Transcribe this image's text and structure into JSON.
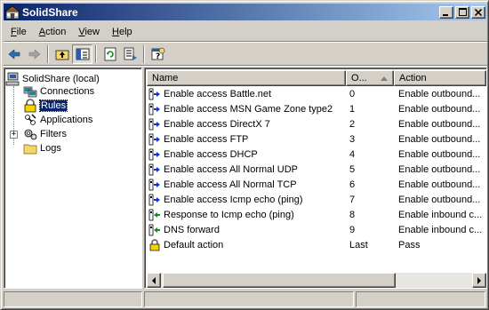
{
  "window": {
    "title": "SolidShare"
  },
  "menu": {
    "items": [
      {
        "label": "File",
        "accel": "F"
      },
      {
        "label": "Action",
        "accel": "A"
      },
      {
        "label": "View",
        "accel": "V"
      },
      {
        "label": "Help",
        "accel": "H"
      }
    ]
  },
  "toolbar": {
    "buttons": [
      "back-icon",
      "forward-icon",
      "up-one-level-icon",
      "show-hide-tree-icon",
      "refresh-icon",
      "export-list-icon",
      "help-icon"
    ]
  },
  "tree": {
    "root": "SolidShare (local)",
    "items": [
      "Connections",
      "Rules",
      "Applications",
      "Filters",
      "Logs"
    ],
    "selected": "Rules",
    "filters_expander": "+"
  },
  "list": {
    "columns": [
      "Name",
      "O...",
      "Action"
    ],
    "rows": [
      {
        "name": "Enable access Battle.net",
        "order": "0",
        "action": "Enable outbound...",
        "dir": "out"
      },
      {
        "name": "Enable access MSN Game Zone type2",
        "order": "1",
        "action": "Enable outbound...",
        "dir": "out"
      },
      {
        "name": "Enable access DirectX 7",
        "order": "2",
        "action": "Enable outbound...",
        "dir": "out"
      },
      {
        "name": "Enable access FTP",
        "order": "3",
        "action": "Enable outbound...",
        "dir": "out"
      },
      {
        "name": "Enable access DHCP",
        "order": "4",
        "action": "Enable outbound...",
        "dir": "out"
      },
      {
        "name": "Enable access All Normal UDP",
        "order": "5",
        "action": "Enable outbound...",
        "dir": "out"
      },
      {
        "name": "Enable access All Normal TCP",
        "order": "6",
        "action": "Enable outbound...",
        "dir": "out"
      },
      {
        "name": "Enable access Icmp echo (ping)",
        "order": "7",
        "action": "Enable outbound...",
        "dir": "out"
      },
      {
        "name": "Response to Icmp echo (ping)",
        "order": "8",
        "action": "Enable inbound c...",
        "dir": "in"
      },
      {
        "name": "DNS forward",
        "order": "9",
        "action": "Enable inbound c...",
        "dir": "in"
      },
      {
        "name": "Default action",
        "order": "Last",
        "action": "Pass",
        "dir": "lock"
      }
    ]
  },
  "colors": {
    "titlebar_start": "#0a246a",
    "titlebar_end": "#a6caf0",
    "selection": "#0a246a",
    "outbound_arrow": "#1a2fd0",
    "inbound_arrow": "#1a8a1a"
  }
}
